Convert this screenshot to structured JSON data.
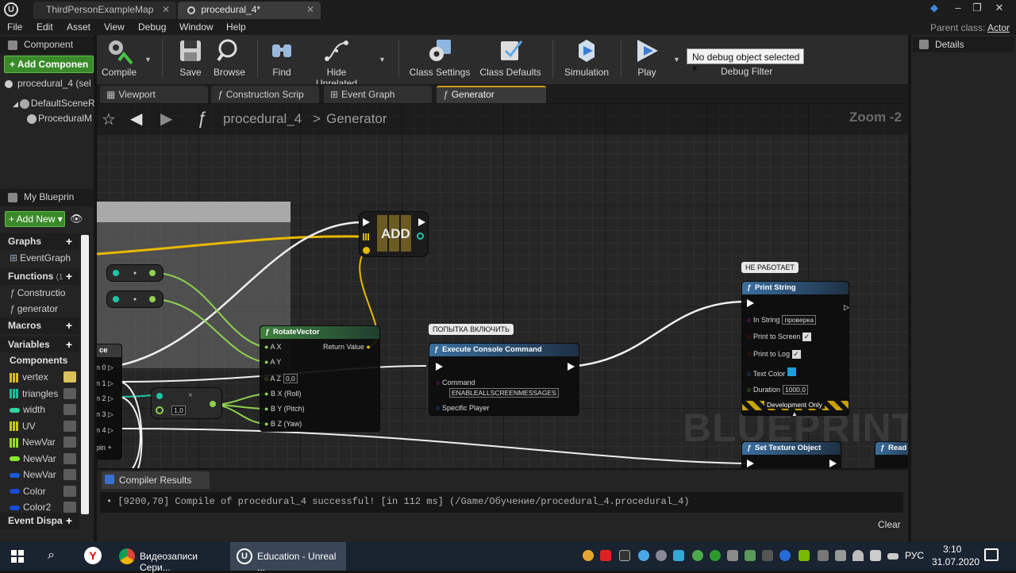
{
  "titlebar": {
    "tabs": [
      "ThirdPersonExampleMap",
      "procedural_4*"
    ]
  },
  "menu": {
    "items": [
      "File",
      "Edit",
      "Asset",
      "View",
      "Debug",
      "Window",
      "Help"
    ],
    "parent_class_label": "Parent class:",
    "parent_class_value": "Actor"
  },
  "components_panel": {
    "title": "Component",
    "add_button": "+ Add Componen",
    "tree": [
      "procedural_4 (sel",
      "DefaultSceneR",
      "ProceduralM"
    ]
  },
  "my_blueprint": {
    "title": "My Blueprin",
    "add_new": "+ Add New",
    "graphs_label": "Graphs",
    "graphs": [
      "EventGraph"
    ],
    "functions_label": "Functions",
    "functions_count": "(1",
    "functions": [
      "Constructio",
      "generator"
    ],
    "macros_label": "Macros",
    "variables_label": "Variables",
    "components_label": "Components",
    "variables": [
      {
        "name": "vertex",
        "color": "#d8b82a"
      },
      {
        "name": "triangles",
        "color": "#1fb89a"
      },
      {
        "name": "width",
        "color": "#2ed3a0"
      },
      {
        "name": "UV",
        "color": "#c8c81a"
      },
      {
        "name": "NewVar",
        "color": "#9ad82a"
      },
      {
        "name": "NewVar",
        "color": "#8ae82a"
      },
      {
        "name": "NewVar",
        "color": "#1a5ad8"
      },
      {
        "name": "Color",
        "color": "#1a4ad8"
      },
      {
        "name": "Color2",
        "color": "#1a4ad8"
      }
    ],
    "event_dispatchers_label": "Event Dispa"
  },
  "toolbar": {
    "buttons": [
      "Compile",
      "Save",
      "Browse",
      "Find",
      "Hide Unrelated",
      "Class Settings",
      "Class Defaults",
      "Simulation",
      "Play"
    ],
    "debug_select": "No debug object selected",
    "debug_filter_label": "Debug Filter"
  },
  "graph_tabs": [
    "Viewport",
    "Construction Scrip",
    "Event Graph",
    "Generator"
  ],
  "graph": {
    "breadcrumb_root": "procedural_4",
    "breadcrumb_sep": ">",
    "breadcrumb_current": "Generator",
    "zoom": "Zoom -2",
    "watermark": "BLUEPRINT",
    "nodes": {
      "add_label": "ADD",
      "rotate_title": "RotateVector",
      "rotate_pins": [
        "A X",
        "A Y",
        "A Z",
        "B X (Roll)",
        "B Y (Pitch)",
        "B Z (Yaw)"
      ],
      "rotate_az_value": "0,0",
      "rotate_return": "Return Value",
      "multiply_value": "1,0",
      "exec_comment": "ПОПЫТКА ВКЛЮЧИТЬ",
      "exec_title": "Execute Console Command",
      "exec_command_label": "Command",
      "exec_command_value": "ENABLEALLSCREENMESSAGES",
      "exec_player": "Specific Player",
      "print_comment": "НЕ РАБОТАЕТ",
      "print_title": "Print String",
      "print_in_string": "In String",
      "print_in_string_value": "проверка",
      "print_to_screen": "Print to Screen",
      "print_to_log": "Print to Log",
      "print_text_color": "Text Color",
      "print_duration": "Duration",
      "print_duration_value": "1000,0",
      "print_dev_only": "Development Only",
      "set_texture_title": "Set Texture Object",
      "read_title": "Read",
      "partial_node_pins": [
        "n 0",
        "n 1",
        "n 2",
        "n 3",
        "n 4"
      ],
      "partial_node_addpin": "pin +",
      "partial_node_head": "ce"
    }
  },
  "compiler": {
    "tab": "Compiler Results",
    "message": "• [9200,70] Compile of procedural_4 successful! [in 112 ms] (/Game/Обучение/procedural_4.procedural_4)",
    "clear": "Clear"
  },
  "details": {
    "title": "Details"
  },
  "taskbar": {
    "tasks": [
      "Видеозаписи Сери...",
      "Education - Unreal ..."
    ],
    "lang": "РУС",
    "time": "3:10",
    "date": "31.07.2020"
  }
}
